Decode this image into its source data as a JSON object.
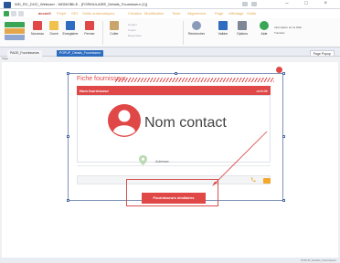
{
  "window": {
    "title": "WD_RC_DOC_Webuser - WDMOBILE - [FORMULAIRE_Détails_Fournisseur (1)]",
    "icon": "app-logo-icon"
  },
  "ribbon_tabs": [
    {
      "label": "accueil",
      "active": true
    },
    {
      "label": "Projet"
    },
    {
      "label": "GEL"
    },
    {
      "label": "Outils automatiques"
    },
    {
      "label": "Création"
    },
    {
      "label": "Modification"
    },
    {
      "label": "Texte"
    },
    {
      "label": "Alignement"
    },
    {
      "label": "Page"
    },
    {
      "label": "Affichage"
    },
    {
      "label": "Outils"
    }
  ],
  "ribbon": {
    "nouveau": "Nouveau",
    "ouvrir": "Ouvrir",
    "enregistrer": "Enregistrer",
    "fermer": "Fermer",
    "coller": "Coller",
    "couper": "Couper",
    "copier": "Copier",
    "reproduire": "Reproduire",
    "rechercher": "Rechercher",
    "valider": "Valider",
    "options": "Options",
    "aide": "Aide",
    "info_site": "Information sur le Web",
    "tutoriels": "Tutoriels"
  },
  "doc_tabs": [
    {
      "label": "PAGE_Fournisseurs"
    },
    {
      "label": "POPUP_Détails_Fournisseur",
      "active": true
    }
  ],
  "page_properties": "Page Popup",
  "page_label": "Page",
  "form": {
    "title": "Fiche fournisseur",
    "header_left": "Nom fournisseur",
    "header_right": "activité",
    "contact_name": "Nom contact",
    "address_label": "Adresse",
    "similar_button": "Fournisseurs similaires"
  },
  "status_bar": "POPUP_Détails_Fournisseur"
}
